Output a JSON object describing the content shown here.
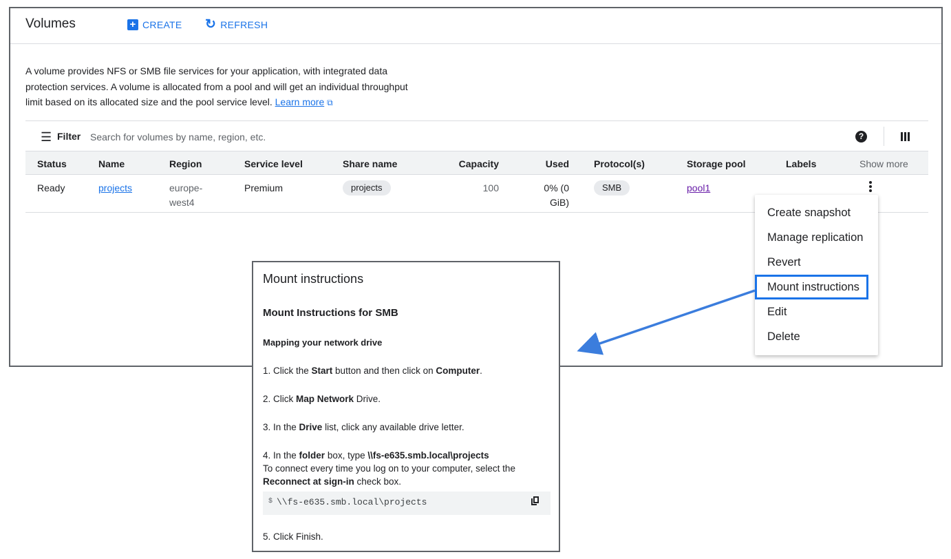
{
  "header": {
    "title": "Volumes",
    "create_label": "CREATE",
    "refresh_label": "REFRESH"
  },
  "description": {
    "text": "A volume provides NFS or SMB file services for your application, with integrated data protection services. A volume is allocated from a pool and will get an individual throughput limit based on its allocated size and the pool service level.",
    "learn_more": "Learn more"
  },
  "filter": {
    "label": "Filter",
    "placeholder": "Search for volumes by name, region, etc."
  },
  "table": {
    "columns": [
      "Status",
      "Name",
      "Region",
      "Service level",
      "Share name",
      "Capacity",
      "Used",
      "Protocol(s)",
      "Storage pool",
      "Labels",
      "Show more"
    ],
    "rows": [
      {
        "status": "Ready",
        "name": "projects",
        "region_line1": "europe-",
        "region_line2": "west4",
        "service_level": "Premium",
        "share_name": "projects",
        "capacity": "100",
        "used_line1": "0% (0",
        "used_line2": "GiB)",
        "protocol": "SMB",
        "storage_pool": "pool1"
      }
    ]
  },
  "menu": {
    "items": [
      "Create snapshot",
      "Manage replication",
      "Revert",
      "Mount instructions",
      "Edit",
      "Delete"
    ],
    "highlighted": "Mount instructions"
  },
  "dialog": {
    "title": "Mount instructions",
    "subtitle": "Mount Instructions for SMB",
    "section": "Mapping your network drive",
    "step1": {
      "a": "1. Click the ",
      "b": "Start",
      "c": " button and then click on ",
      "d": "Computer",
      "e": "."
    },
    "step2": {
      "a": "2. Click ",
      "b": "Map Network",
      "c": " Drive."
    },
    "step3": {
      "a": "3. In the ",
      "b": "Drive",
      "c": " list, click any available drive letter."
    },
    "step4": {
      "a": "4. In the ",
      "b": "folder",
      "c": " box, type ",
      "d": "\\\\fs-e635.smb.local\\projects",
      "e": "To connect every time you log on to your computer, select the ",
      "f": "Reconnect at sign-in",
      "g": " check box."
    },
    "code_prompt": "$",
    "code": "\\\\fs-e635.smb.local\\projects",
    "step5": "5. Click Finish."
  },
  "colors": {
    "accent": "#1a73e8",
    "visited_link": "#681da8",
    "arrow": "#3b7ddd"
  }
}
